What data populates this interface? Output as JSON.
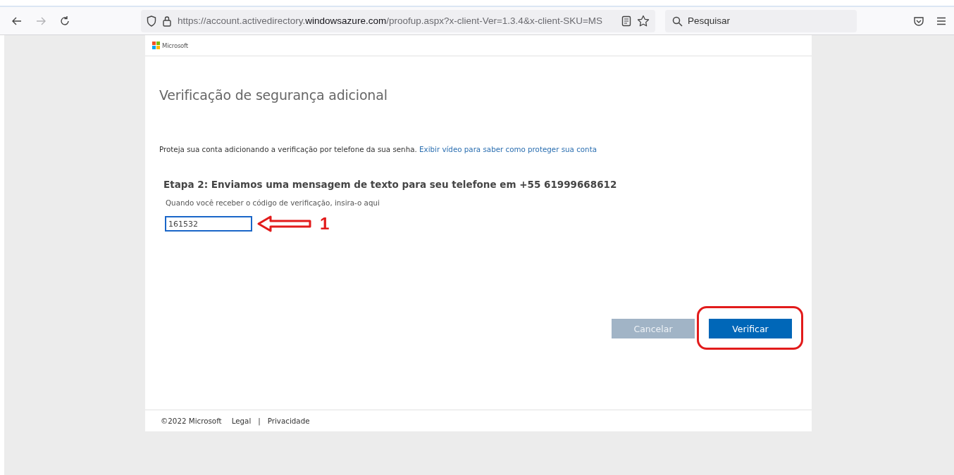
{
  "browser": {
    "nav": [
      {
        "kind": "back",
        "disabled": false
      },
      {
        "kind": "forward",
        "disabled": true
      },
      {
        "kind": "reload",
        "disabled": false
      }
    ],
    "url": "https://account.activedirectory.**windowsazure.com**/proofup.aspx?x-client-Ver=1.3.4&x-client-SKU=MS",
    "search": {
      "placeholder": "Pesquisar"
    }
  },
  "page": {
    "brand": "Microsoft",
    "title": "Verificação de segurança adicional",
    "intro": "Proteja sua conta adicionando a verificação por telefone da sua senha.",
    "intro_link": "Exibir vídeo para saber como proteger sua conta",
    "step_heading": "Etapa 2: Enviamos uma mensagem de texto para seu telefone em +55 61999668612",
    "code_label": "Quando você receber o código de verificação, insira-o aqui",
    "code_value": "161532",
    "buttons": [
      {
        "label": "Cancelar",
        "kind": "secondary"
      },
      {
        "label": "Verificar",
        "kind": "primary"
      }
    ],
    "footer": {
      "copyright": "©2022 Microsoft",
      "links": [
        "Legal",
        "Privacidade"
      ],
      "separator": "|"
    }
  },
  "annotation": {
    "label": "1"
  }
}
